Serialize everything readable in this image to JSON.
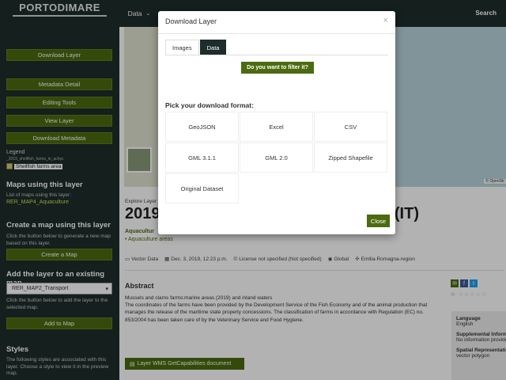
{
  "brand": {
    "logo_text": "PORTODIMARE"
  },
  "topbar": {
    "data_menu": "Data",
    "search": "Search"
  },
  "sidebar": {
    "buttons": {
      "download_layer": "Download Layer",
      "metadata_detail": "Metadata Detail",
      "editing_tools": "Editing Tools",
      "view_layer": "View Layer",
      "download_metadata": "Download Metadata"
    },
    "legend": {
      "title": "Legend",
      "layer_name": "_2019_shellfish_farms_in_achyc",
      "item": "Shellfish farms area",
      "swatch_color": "#d7c67d"
    },
    "maps_using": {
      "heading": "Maps using this layer",
      "text": "List of maps using this layer:",
      "link": "RER_MAP4_Aquaculture"
    },
    "create_map": {
      "heading": "Create a map using this layer",
      "text": "Click the button below to generate a new map based on this layer.",
      "button": "Create a Map"
    },
    "add_layer": {
      "heading": "Add the layer to an existing map",
      "select_value": "RER_MAP2_Transport",
      "text": "Click the button below to add the layer to the selected map.",
      "button": "Add to Map"
    },
    "styles": {
      "heading": "Styles",
      "text": "The following styles are associated with this layer. Choose a style to view it in the preview map."
    }
  },
  "map": {
    "attribution": "© OpenStr"
  },
  "main": {
    "breadcrumb": "Explore Layer",
    "title_start": "2019",
    "title_end": "na (IT)",
    "subtitle": "Aquacultur",
    "category": "• Aquaculture areas",
    "meta": {
      "type": "Vector Data",
      "date": "Dec. 3, 2019, 12:23 p.m.",
      "license": "License not specified (Not specified)",
      "scope": "Global",
      "region": "Emilia-Romagna-region"
    },
    "abstract_heading": "Abstract",
    "abstract_lines": [
      "Mussels and clams farms:marine areas (2019) and inland waters",
      "The coordinates of the farms have been provided by the Development Service of the Fish Economy and of the animal production that manages the release of the maritime state property concessions. The classification of farms in accordance with Regulation (EC) no. 853/2004 has been taken care of by the Veterinary Service and Food Hygiene."
    ],
    "wms_button": "Layer WMS GetCapabilities document",
    "rating_stars": 0,
    "info": [
      {
        "key": "Language",
        "value": "English"
      },
      {
        "key": "Supplemental Information",
        "value": "No information provided"
      },
      {
        "key": "Spatial Representation Type",
        "value": "vector polygon"
      }
    ]
  },
  "modal": {
    "title": "Download Layer",
    "close_icon": "×",
    "tabs": [
      "Images",
      "Data"
    ],
    "active_tab": "Data",
    "filter_button": "Do you want to filter it?",
    "format_heading": "Pick your download format:",
    "formats": [
      "GeoJSON",
      "Excel",
      "CSV",
      "GML 3.1.1",
      "GML 2.0",
      "Zipped Shapefile",
      "Original Dataset"
    ],
    "close_button": "Close"
  },
  "colors": {
    "accent": "#4b6b10",
    "sidebar_bg": "#1d2d2b",
    "link": "#c9e04f"
  }
}
